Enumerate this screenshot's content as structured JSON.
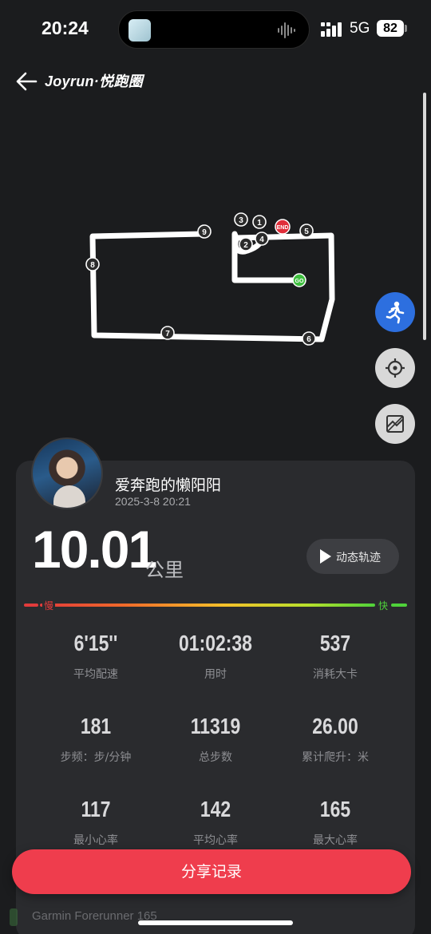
{
  "status_bar": {
    "time": "20:24",
    "network": "5G",
    "battery": "82"
  },
  "header": {
    "brand": "Joyrun·悦跑圈"
  },
  "map": {
    "markers": [
      "1",
      "2",
      "3",
      "4",
      "5",
      "6",
      "7",
      "8",
      "9"
    ],
    "end_label": "END",
    "start_label": "GO"
  },
  "record": {
    "username": "爱奔跑的懒阳阳",
    "datetime": "2025-3-8 20:21",
    "distance": "10.01",
    "distance_unit": "公里",
    "replay_label": "动态轨迹"
  },
  "pace_legend": {
    "slow": "慢",
    "fast": "快"
  },
  "stats": [
    {
      "value": "6'15''",
      "label": "平均配速"
    },
    {
      "value": "01:02:38",
      "label": "用时"
    },
    {
      "value": "537",
      "label": "消耗大卡"
    },
    {
      "value": "181",
      "label": "步频：步/分钟"
    },
    {
      "value": "11319",
      "label": "总步数"
    },
    {
      "value": "26.00",
      "label": "累计爬升：米"
    },
    {
      "value": "117",
      "label": "最小心率"
    },
    {
      "value": "142",
      "label": "平均心率"
    },
    {
      "value": "165",
      "label": "最大心率"
    }
  ],
  "share_label": "分享记录",
  "device_label": "Garmin Forerunner 165"
}
